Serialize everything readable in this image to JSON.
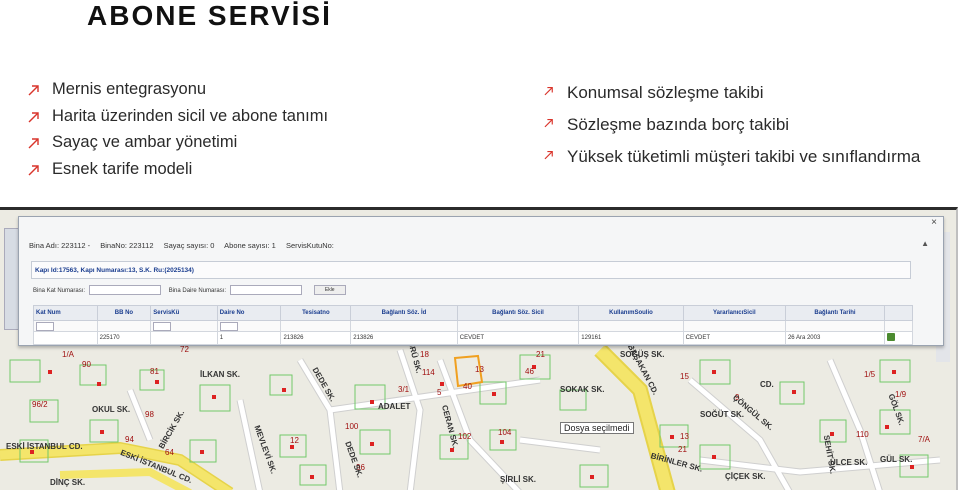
{
  "title": "ABONE SERVİSİ",
  "left_bullets": [
    "Mernis entegrasyonu",
    "Harita üzerinden sicil ve abone tanımı",
    "Sayaç ve ambar yönetimi",
    "Esnek tarife modeli"
  ],
  "right_bullets": [
    "Konumsal sözleşme takibi",
    "Sözleşme bazında borç takibi",
    "Yüksek tüketimli müşteri takibi ve sınıflandırma"
  ],
  "screenshot": {
    "dialog": {
      "close": "×",
      "header": [
        "Bina Adı: 223112 -",
        "BinaNo: 223112",
        "Sayaç sayısı: 0",
        "Abone sayısı: 1",
        "ServisKutuNo:"
      ],
      "header_right": "▲",
      "info": "Kapı Id:17563, Kapı Numarası:13, S.K. Ru:(2025134)",
      "form": {
        "floor_label": "Bina Kat Numarası:",
        "unit_label": "Bina Daire Numarası:",
        "add_button": "Ekle"
      },
      "columns": [
        "Kat Num",
        "BB No",
        "ServisKü",
        "Daire No",
        "Tesisatno",
        "Bağlantı Söz. İd",
        "Bağlantı Söz. Sicil",
        "KullanımSoulio",
        "YararlanıcıSicil",
        "Bağlantı Tarihi",
        ""
      ],
      "row": [
        "",
        "225170",
        "",
        "1",
        "213826",
        "213826",
        "CEVDET",
        "129161",
        "CEVDET",
        "26 Ara 2003",
        ""
      ]
    },
    "map": {
      "tooltip": "Dosya seçilmedi",
      "roads": [
        "ESKİ İSTANBUL CD.",
        "ESKİ İSTANBUL CD.",
        "BAŞAKAN CD.",
        "ADALET",
        "DEDE SK.",
        "BİRCİK SK.",
        "SÜRÜ SK.",
        "CERAN SK.",
        "DEDE SK.",
        "ÇÖNGÜL SK.",
        "SEHİT SK.",
        "ÜLCE SK.",
        "SOĞÜŞ SK.",
        "BİRİNLER SK.",
        "ŞİRLİ SK.",
        "ÇİÇEK SK.",
        "GÖL SK.",
        "MEVLEVİ SK.",
        "CD.",
        "SOKAK SK.",
        "GÜL SK.",
        "İLKAN SK.",
        "SOĞÜT SK.",
        "OKUL SK.",
        "DİNÇ SK."
      ],
      "parcel_labels": [
        "1/A",
        "90",
        "81",
        "96/2",
        "98",
        "72",
        "13",
        "3/1",
        "18",
        "104",
        "100",
        "102",
        "96",
        "40",
        "64",
        "94",
        "12",
        "110",
        "1/9",
        "1/5",
        "7/A",
        "114",
        "5",
        "15",
        "13",
        "21",
        "21",
        "46",
        "9"
      ]
    }
  },
  "colors": {
    "arrow": "#d9342b",
    "link": "#1a3d8f",
    "parcel_label": "#a01010"
  }
}
